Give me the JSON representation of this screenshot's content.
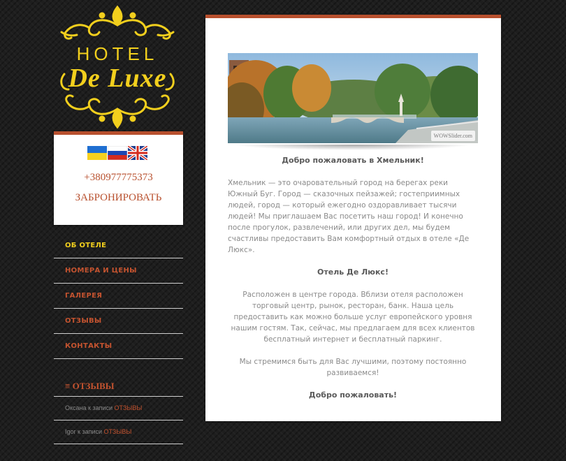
{
  "logo": {
    "line1": "HOTEL",
    "line2": "De Luxe"
  },
  "contact": {
    "flags": [
      "ukraine-flag",
      "russia-flag",
      "uk-flag"
    ],
    "phone": "+380977775373",
    "book_label": "ЗАБРОНИРОВАТЬ"
  },
  "nav": {
    "items": [
      {
        "label": "ОБ ОТЕЛЕ",
        "active": true
      },
      {
        "label": "НОМЕРА И ЦЕНЫ",
        "active": false
      },
      {
        "label": "ГАЛЕРЕЯ",
        "active": false
      },
      {
        "label": "ОТЗЫВЫ",
        "active": false
      },
      {
        "label": "КОНТАКТЫ",
        "active": false
      }
    ]
  },
  "reviews": {
    "title": "ОТЗЫВЫ",
    "items": [
      {
        "author": "Оксана к записи",
        "link": "ОТЗЫВЫ"
      },
      {
        "author": "Igor к записи",
        "link": "ОТЗЫВЫ"
      }
    ]
  },
  "main": {
    "slider_watermark": "WOWSlider.com",
    "welcome_title": "Добро пожаловать в Хмельник!",
    "intro": "Хмельник — это очаровательный город на берегах реки Южный Буг. Город — сказочных пейзажей; гостеприимных людей, город — который ежегодно оздоравливает тысячи людей! Мы приглашаем Вас посетить наш город! И конечно после прогулок, развлечений, или других дел, мы будем счастливы предоставить Вам комфортный отдых в отеле «Де Люкс».",
    "hotel_title": "Отель Де Люкс!",
    "location": "Расположен в центре города. Вблизи отеля расположен торговый центр, рынок, ресторан, банк. Наша цель предоставить как можно больше услуг европейского уровня нашим гостям. Так, сейчас, мы предлагаем для всех клиентов бесплатный интернет и бесплатный паркинг.",
    "promise": "Мы стремимся быть для Вас лучшими, поэтому постоянно развиваемся!",
    "closing": "Добро пожаловать!"
  },
  "colors": {
    "accent": "#b8502e",
    "gold": "#f2cf1d",
    "background": "#1e1e1e"
  }
}
